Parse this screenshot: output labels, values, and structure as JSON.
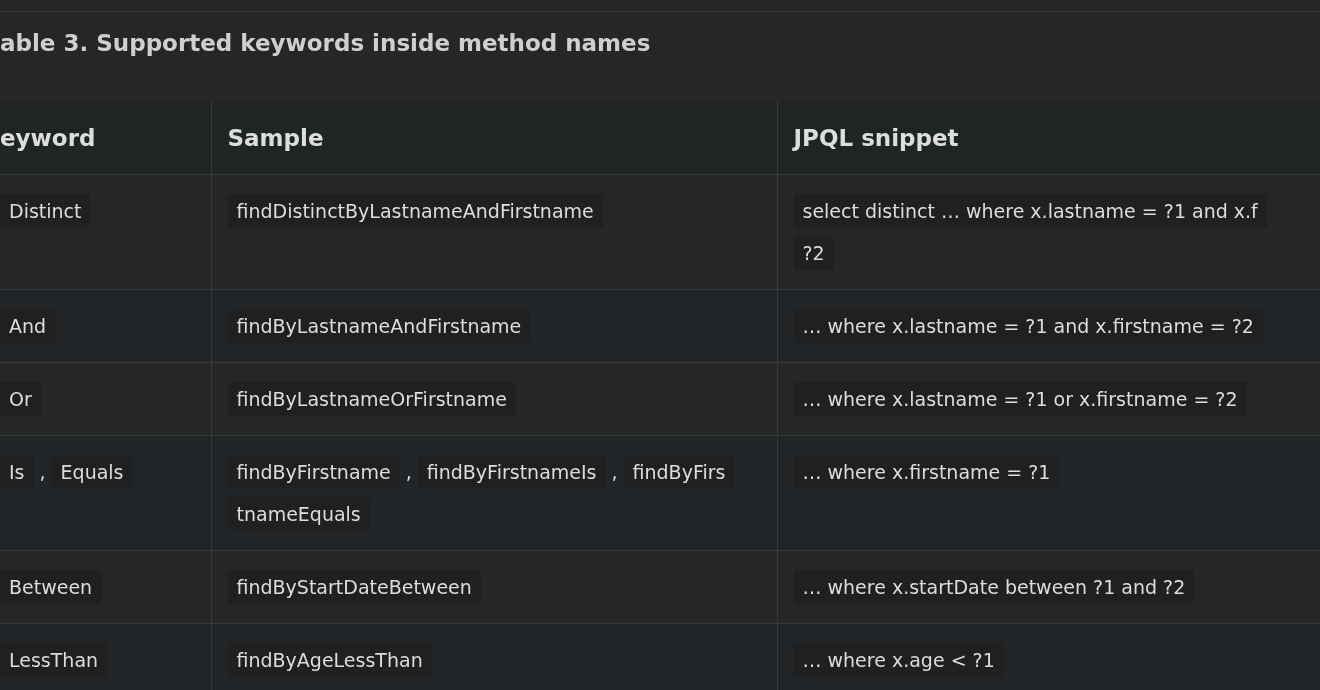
{
  "caption": "able 3. Supported keywords inside method names",
  "table": {
    "columns": [
      "eyword",
      "Sample",
      "JPQL snippet"
    ],
    "rows": [
      {
        "keyword": [
          [
            {
              "kind": "code",
              "text": "Distinct"
            }
          ]
        ],
        "sample": [
          [
            {
              "kind": "code",
              "text": "findDistinctByLastnameAndFirstname"
            }
          ]
        ],
        "jpql": [
          [
            {
              "kind": "code",
              "text": "select distinct … where x.lastname = ?1 and x.f"
            }
          ],
          [
            {
              "kind": "code",
              "text": "?2"
            }
          ]
        ]
      },
      {
        "keyword": [
          [
            {
              "kind": "code",
              "text": "And"
            }
          ]
        ],
        "sample": [
          [
            {
              "kind": "code",
              "text": "findByLastnameAndFirstname"
            }
          ]
        ],
        "jpql": [
          [
            {
              "kind": "code",
              "text": "… where x.lastname = ?1 and x.firstname = ?2"
            }
          ]
        ]
      },
      {
        "keyword": [
          [
            {
              "kind": "code",
              "text": "Or"
            }
          ]
        ],
        "sample": [
          [
            {
              "kind": "code",
              "text": "findByLastnameOrFirstname"
            }
          ]
        ],
        "jpql": [
          [
            {
              "kind": "code",
              "text": "… where x.lastname = ?1 or x.firstname = ?2"
            }
          ]
        ]
      },
      {
        "keyword": [
          [
            {
              "kind": "code",
              "text": "Is"
            },
            {
              "kind": "text",
              "text": ","
            },
            {
              "kind": "code",
              "text": "Equals"
            }
          ]
        ],
        "sample": [
          [
            {
              "kind": "code",
              "text": "findByFirstname"
            },
            {
              "kind": "text",
              "text": ","
            },
            {
              "kind": "code",
              "text": "findByFirstnameIs"
            },
            {
              "kind": "text",
              "text": ","
            },
            {
              "kind": "code",
              "text": "findByFirs"
            }
          ],
          [
            {
              "kind": "code",
              "text": "tnameEquals"
            }
          ]
        ],
        "jpql": [
          [
            {
              "kind": "code",
              "text": "… where x.firstname = ?1"
            }
          ]
        ]
      },
      {
        "keyword": [
          [
            {
              "kind": "code",
              "text": "Between"
            }
          ]
        ],
        "sample": [
          [
            {
              "kind": "code",
              "text": "findByStartDateBetween"
            }
          ]
        ],
        "jpql": [
          [
            {
              "kind": "code",
              "text": "… where x.startDate between ?1 and ?2"
            }
          ]
        ]
      },
      {
        "keyword": [
          [
            {
              "kind": "code",
              "text": "LessThan"
            }
          ]
        ],
        "sample": [
          [
            {
              "kind": "code",
              "text": "findByAgeLessThan"
            }
          ]
        ],
        "jpql": [
          [
            {
              "kind": "code",
              "text": "… where x.age < ?1"
            }
          ]
        ]
      }
    ]
  }
}
